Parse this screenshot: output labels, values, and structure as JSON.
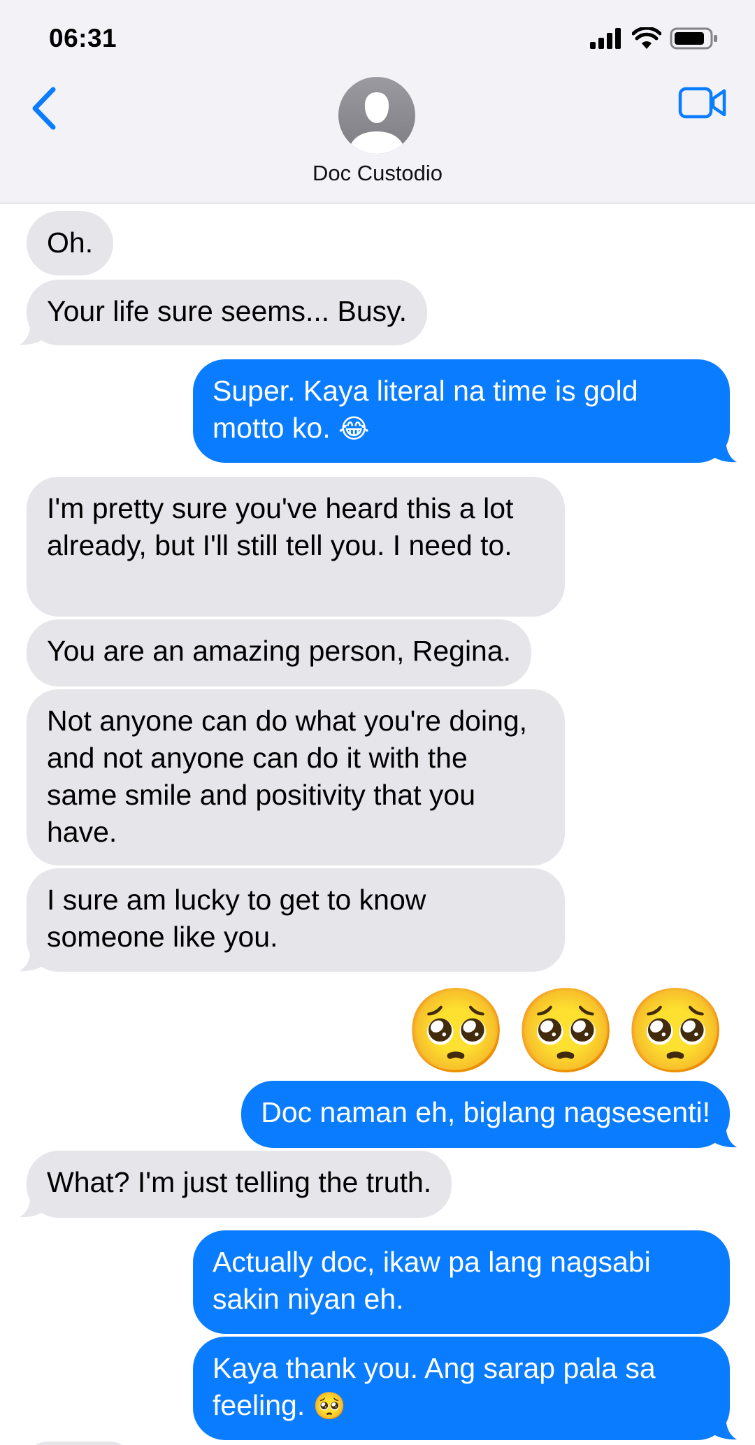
{
  "status_bar": {
    "time": "06:31"
  },
  "header": {
    "contact_name": "Doc Custodio"
  },
  "colors": {
    "incoming_bubble": "#e5e5ea",
    "outgoing_bubble": "#0a7cff",
    "accent": "#0a7cff"
  },
  "icons": {
    "back": "chevron-left-icon",
    "video": "video-camera-icon",
    "avatar": "person-silhouette-icon"
  },
  "messages": [
    {
      "from": "contact",
      "text": "Oh."
    },
    {
      "from": "contact",
      "text": "Your life sure seems... Busy."
    },
    {
      "from": "me",
      "text": "Super. Kaya literal na time is gold motto ko.",
      "emoji": "😂"
    },
    {
      "from": "contact",
      "text": "I'm pretty sure you've heard this a lot already, but I'll still tell you. I need to."
    },
    {
      "from": "contact",
      "text": "You are an amazing person, Regina."
    },
    {
      "from": "contact",
      "text": "Not anyone can do what you're doing, and not anyone can do it with the same smile and positivity that you have."
    },
    {
      "from": "contact",
      "text": "I sure am lucky to get to know someone like you."
    },
    {
      "from": "me",
      "emoji_only": [
        "🥺",
        "🥺",
        "🥺"
      ]
    },
    {
      "from": "me",
      "text": "Doc naman eh, biglang nagsesenti!"
    },
    {
      "from": "contact",
      "text": "What? I'm just telling the truth."
    },
    {
      "from": "me",
      "text": "Actually doc, ikaw pa lang nagsabi sakin niyan eh."
    },
    {
      "from": "me",
      "text": "Kaya thank you. Ang sarap pala sa feeling.",
      "emoji": "🥺"
    }
  ]
}
